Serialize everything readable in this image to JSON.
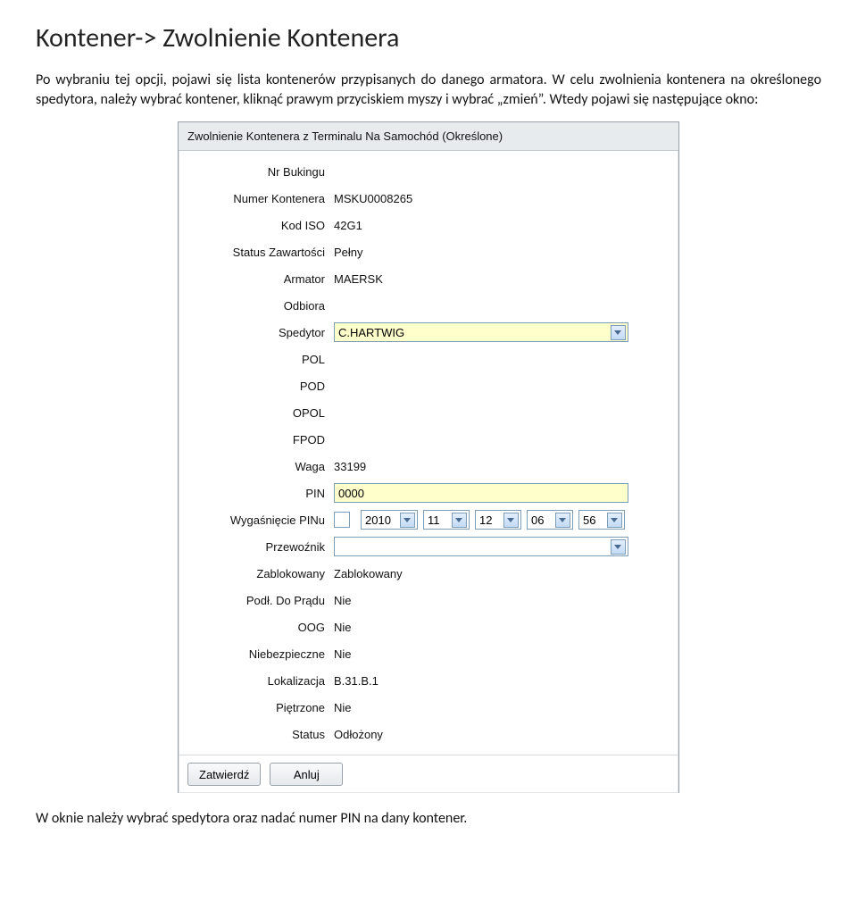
{
  "heading": "Kontener-> Zwolnienie Kontenera",
  "intro": "Po wybraniu tej opcji, pojawi się lista kontenerów przypisanych do danego armatora. W celu zwolnienia kontenera na określonego spedytora, należy wybrać kontener, kliknąć prawym przyciskiem myszy i wybrać „zmień”. Wtedy pojawi się następujące okno:",
  "outro": "W oknie należy wybrać spedytora oraz nadać numer PIN na dany kontener.",
  "panel": {
    "title": "Zwolnienie Kontenera z Terminalu Na Samochód (Określone)"
  },
  "form": {
    "labels": {
      "nr_bukingu": "Nr Bukingu",
      "numer_kontenera": "Numer Kontenera",
      "kod_iso": "Kod ISO",
      "status_zaw": "Status Zawartości",
      "armator": "Armator",
      "odbiorca": "Odbiora",
      "spedytor": "Spedytor",
      "pol": "POL",
      "pod": "POD",
      "opol": "OPOL",
      "fpod": "FPOD",
      "waga": "Waga",
      "pin": "PIN",
      "wygasniecie": "Wygaśnięcie PINu",
      "przewoznik": "Przewoźnik",
      "zablokowany": "Zablokowany",
      "podl_prad": "Podł. Do Prądu",
      "oog": "OOG",
      "niebezp": "Niebezpieczne",
      "lokalizacja": "Lokalizacja",
      "pietrzone": "Piętrzone",
      "status": "Status"
    },
    "values": {
      "nr_bukingu": "",
      "numer_kontenera": "MSKU0008265",
      "kod_iso": "42G1",
      "status_zaw": "Pełny",
      "armator": "MAERSK",
      "odbiorca": "",
      "spedytor": "C.HARTWIG",
      "pol": "",
      "pod": "",
      "opol": "",
      "fpod": "",
      "waga": "33199",
      "pin": "0000",
      "wyg_year": "2010",
      "wyg_month": "11",
      "wyg_day": "12",
      "wyg_hour": "06",
      "wyg_min": "56",
      "przewoznik": "",
      "zablokowany": "Zablokowany",
      "podl_prad": "Nie",
      "oog": "Nie",
      "niebezp": "Nie",
      "lokalizacja": "B.31.B.1",
      "pietrzone": "Nie",
      "status": "Odłożony"
    }
  },
  "buttons": {
    "ok": "Zatwierdź",
    "cancel": "Anluj"
  }
}
